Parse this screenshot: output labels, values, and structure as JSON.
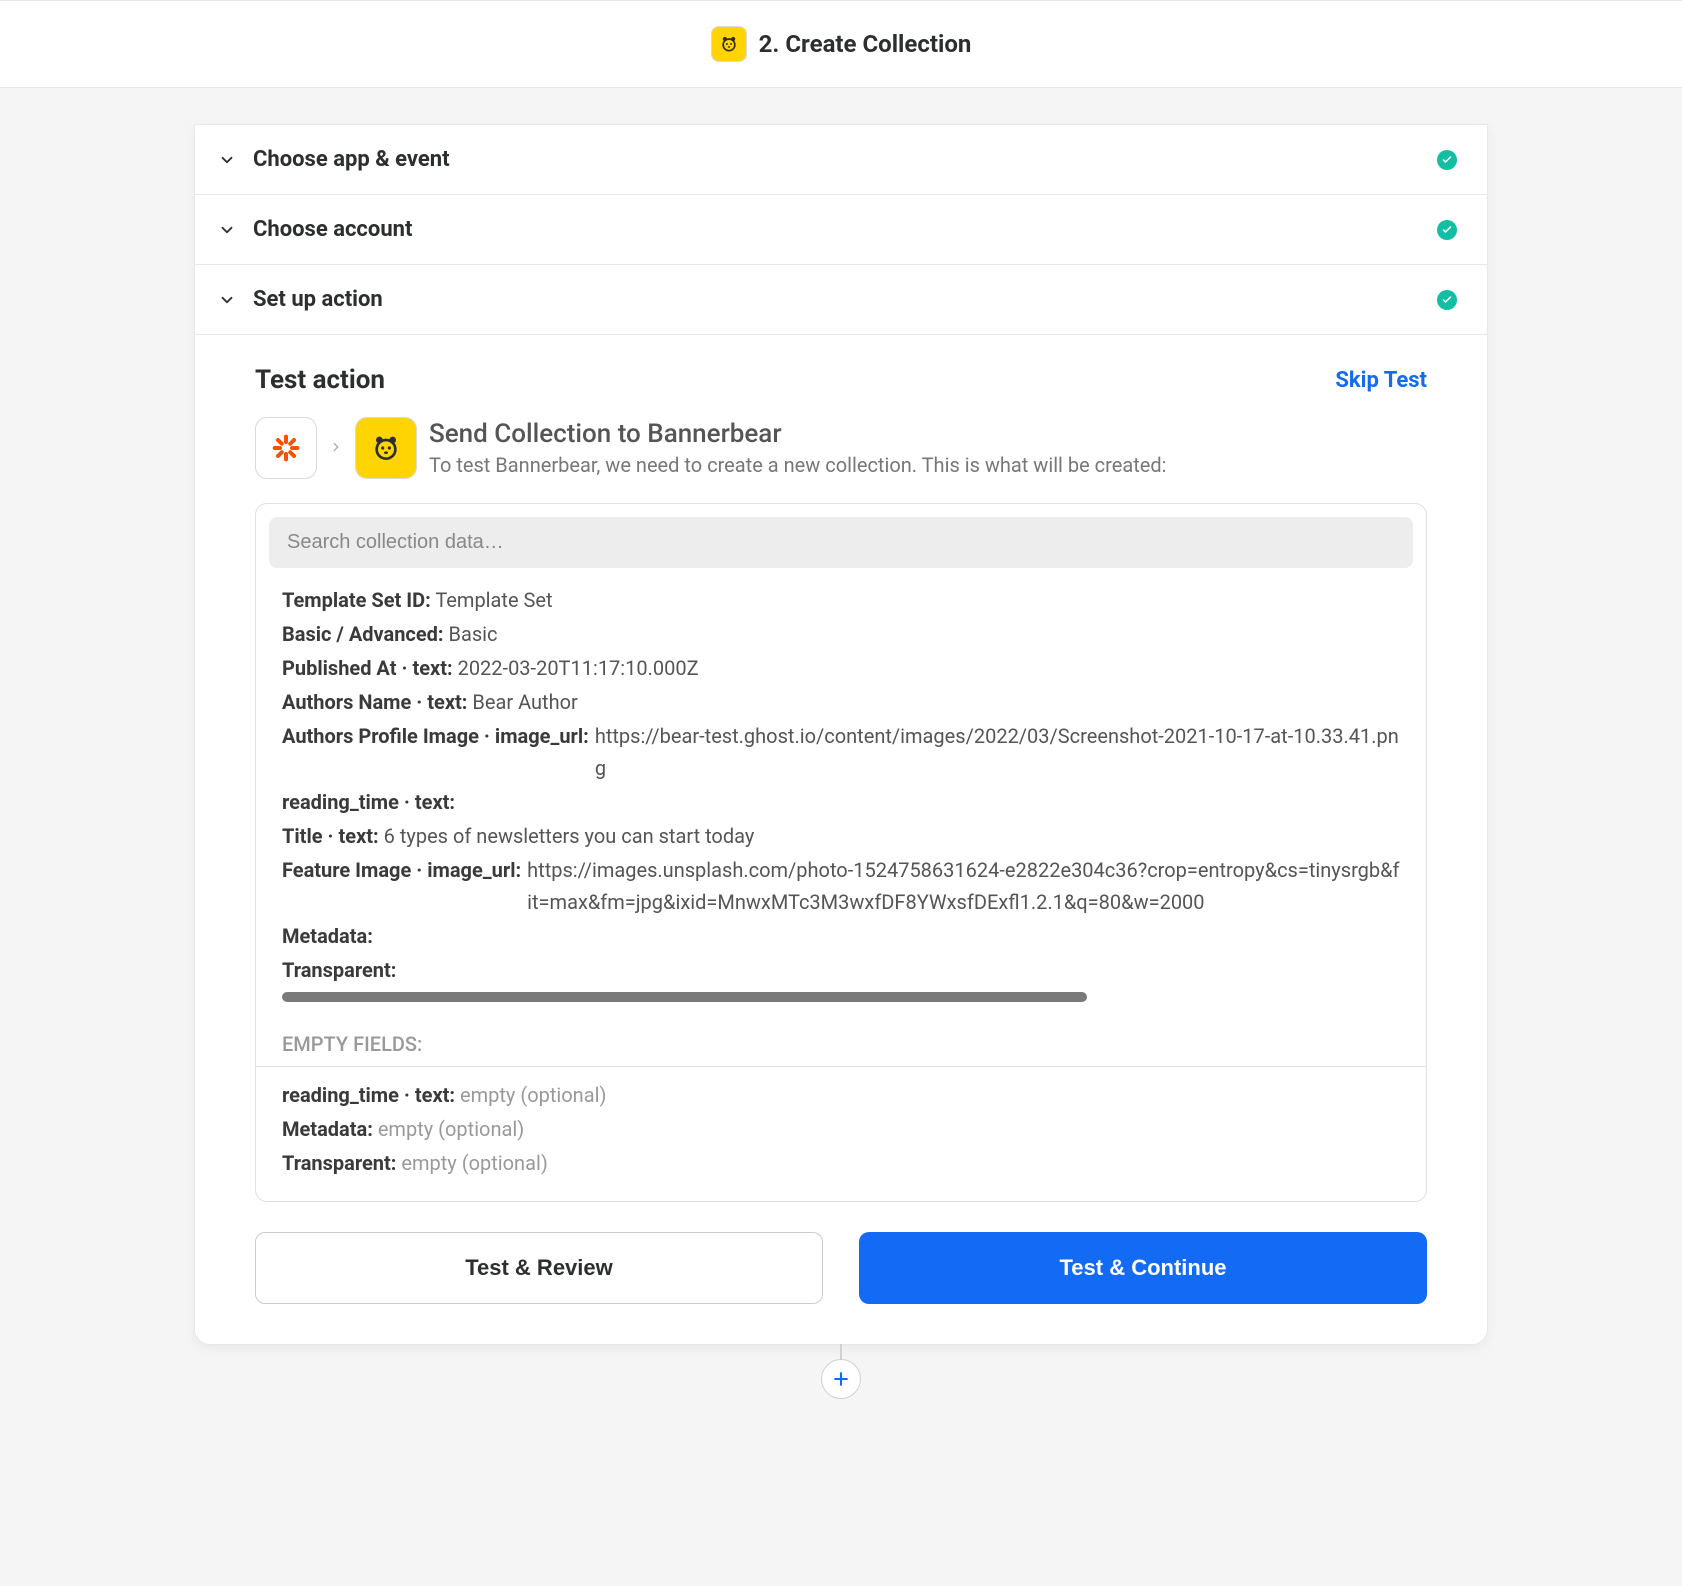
{
  "header": {
    "title": "2. Create Collection"
  },
  "sections": {
    "choose_app": "Choose app & event",
    "choose_account": "Choose account",
    "setup_action": "Set up action"
  },
  "test": {
    "title": "Test action",
    "skip_label": "Skip Test",
    "flow_title": "Send Collection to Bannerbear",
    "flow_desc": "To test Bannerbear, we need to create a new collection. This is what will be created:",
    "search_placeholder": "Search collection data…"
  },
  "data_fields": {
    "template_set_id": {
      "label": "Template Set ID:",
      "value": "Template Set"
    },
    "basic_advanced": {
      "label": "Basic / Advanced:",
      "value": "Basic"
    },
    "published_at": {
      "label": "Published At · text:",
      "value": "2022-03-20T11:17:10.000Z"
    },
    "authors_name": {
      "label": "Authors Name · text:",
      "value": "Bear Author"
    },
    "authors_profile_image": {
      "label": "Authors Profile Image · image_url:",
      "value": "https://bear-test.ghost.io/content/images/2022/03/Screenshot-2021-10-17-at-10.33.41.png"
    },
    "reading_time": {
      "label": "reading_time · text:",
      "value": ""
    },
    "title": {
      "label": "Title · text:",
      "value": "6 types of newsletters you can start today"
    },
    "feature_image": {
      "label": "Feature Image · image_url:",
      "value": "https://images.unsplash.com/photo-1524758631624-e2822e304c36?crop=entropy&cs=tinysrgb&fit=max&fm=jpg&ixid=MnwxMTc3M3wxfDF8YWxsfDExfl1.2.1&q=80&w=2000"
    },
    "metadata": {
      "label": "Metadata:",
      "value": ""
    },
    "transparent": {
      "label": "Transparent:",
      "value": ""
    }
  },
  "empty_section": {
    "header": "EMPTY FIELDS:",
    "reading_time": {
      "label": "reading_time · text:",
      "value": "empty (optional)"
    },
    "metadata": {
      "label": "Metadata:",
      "value": "empty (optional)"
    },
    "transparent": {
      "label": "Transparent:",
      "value": "empty (optional)"
    }
  },
  "buttons": {
    "test_review": "Test & Review",
    "test_continue": "Test & Continue"
  }
}
